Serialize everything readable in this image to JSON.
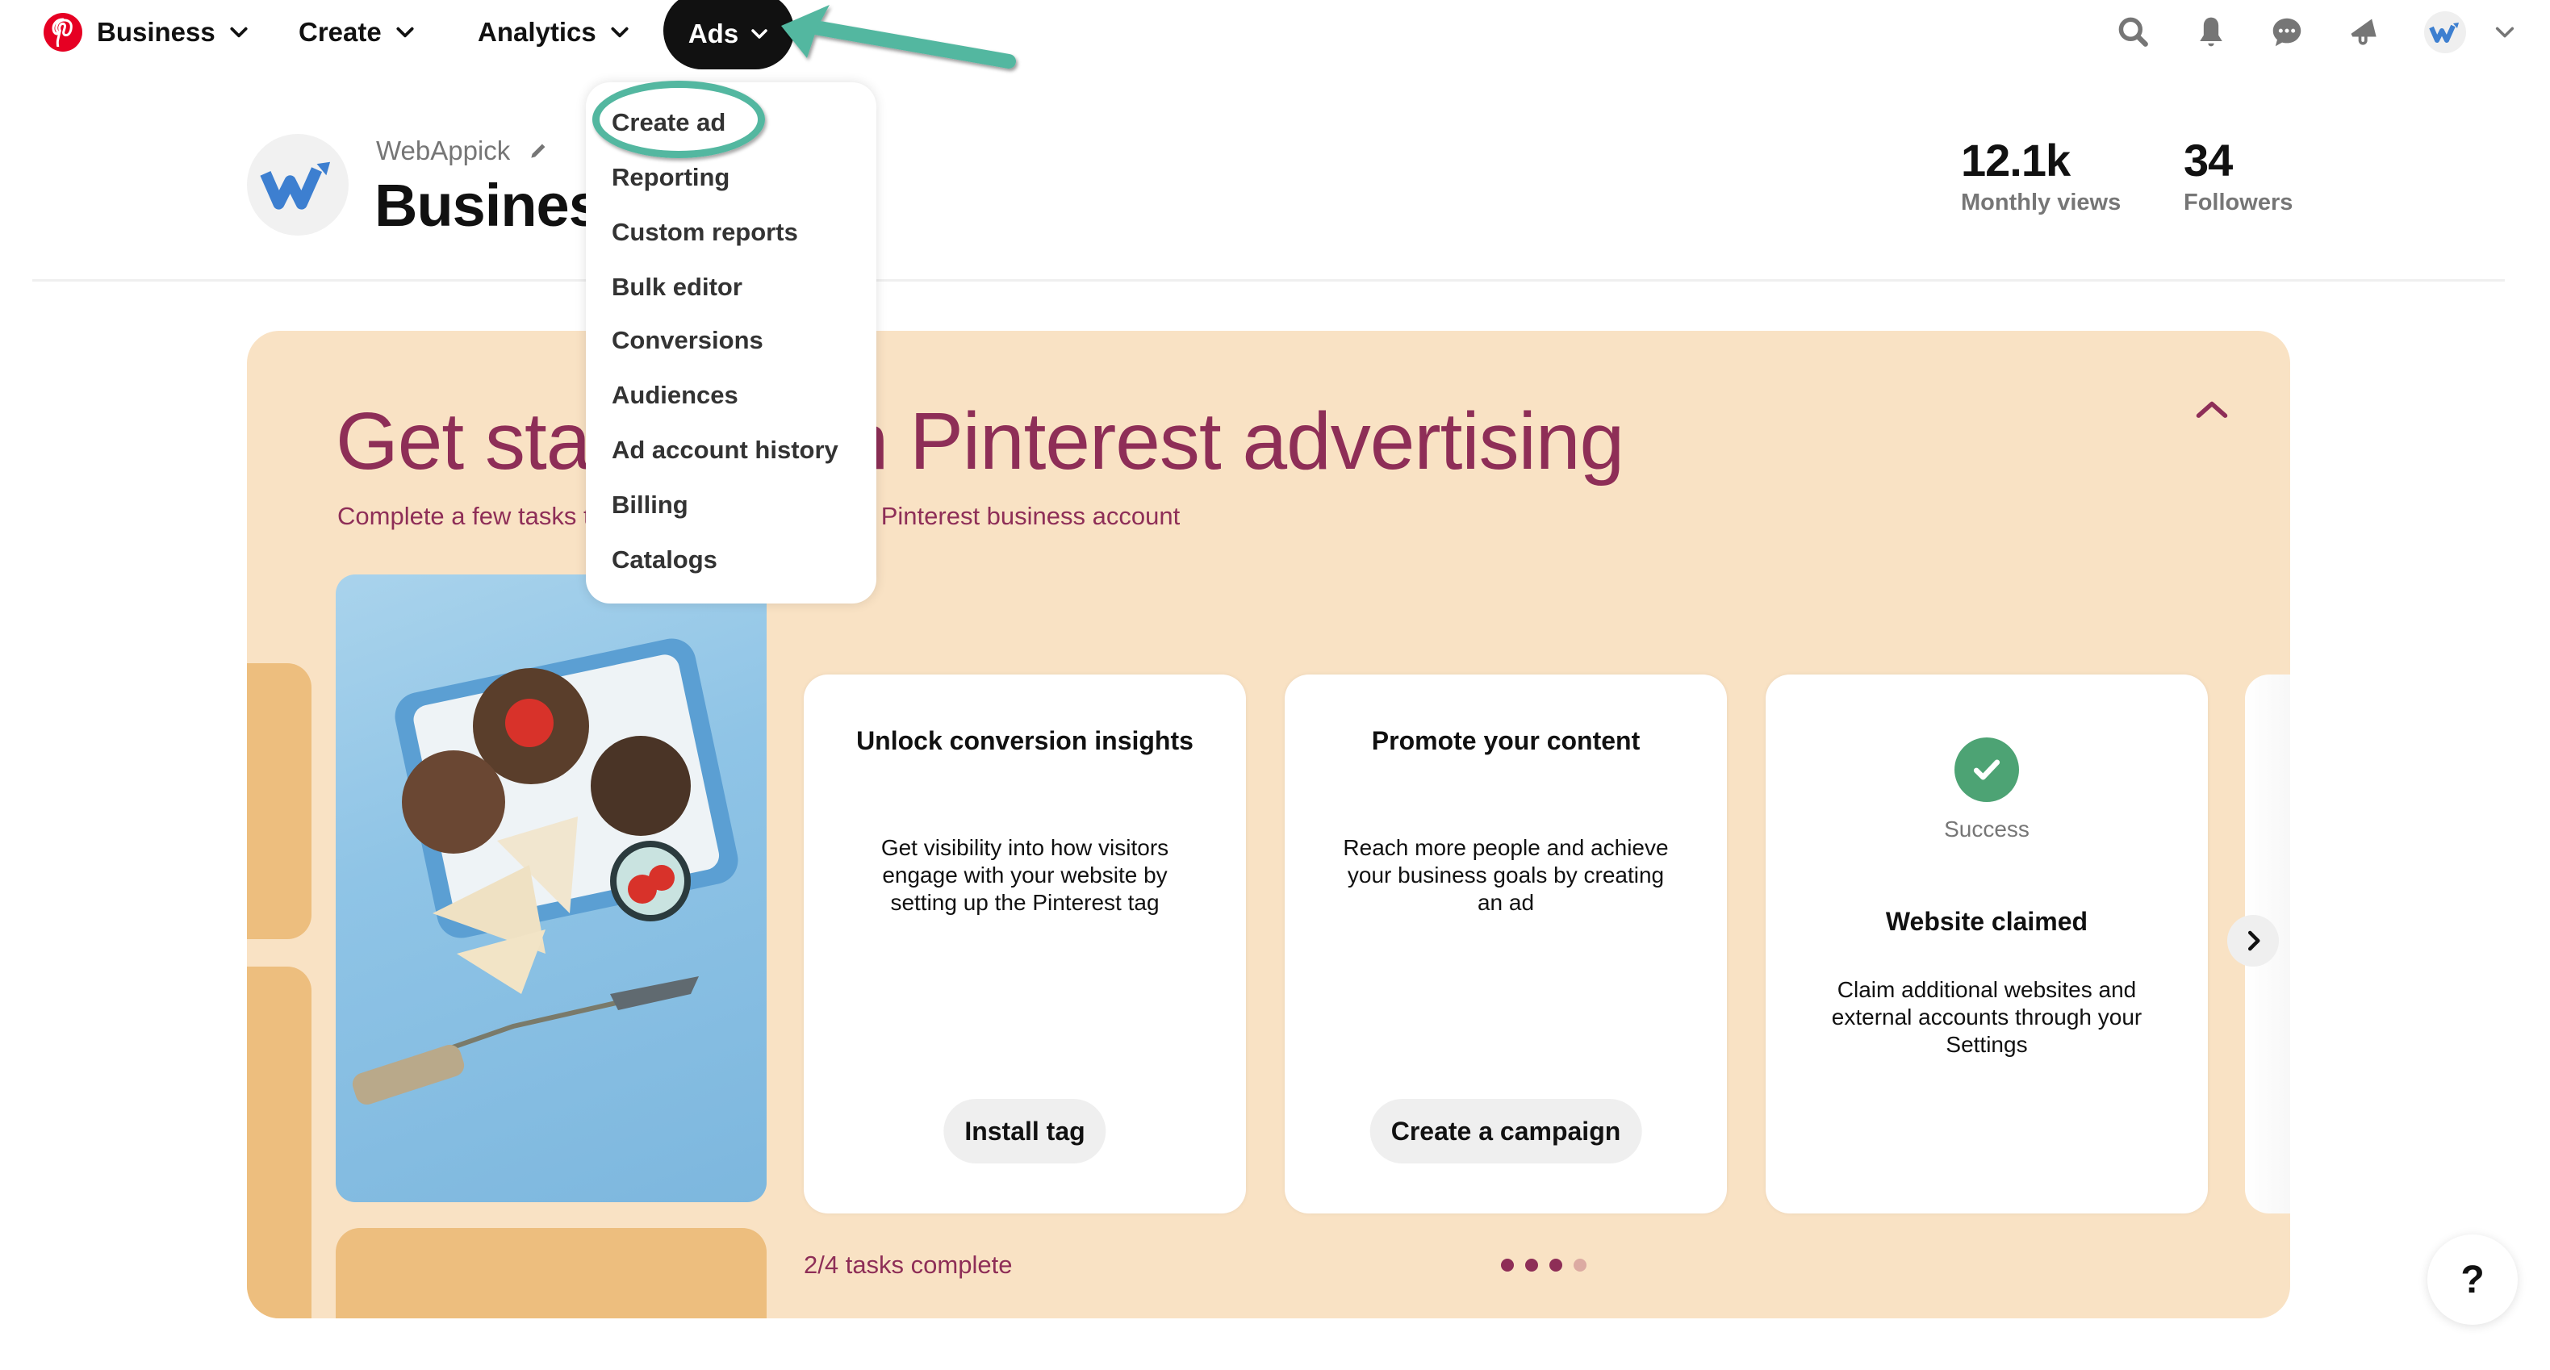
{
  "nav": {
    "items": [
      {
        "label": "Business",
        "icon": "chevron-down-icon"
      },
      {
        "label": "Create",
        "icon": "chevron-down-icon"
      },
      {
        "label": "Analytics",
        "icon": "chevron-down-icon"
      },
      {
        "label": "Ads",
        "icon": "chevron-down-icon",
        "active": true
      }
    ],
    "right_icons": [
      "search-icon",
      "bell-icon",
      "chat-icon",
      "megaphone-icon",
      "account-avatar",
      "chevron-down-icon"
    ]
  },
  "ads_menu": {
    "items": [
      "Create ad",
      "Reporting",
      "Custom reports",
      "Bulk editor",
      "Conversions",
      "Audiences",
      "Ad account history",
      "Billing",
      "Catalogs"
    ],
    "highlighted": "Create ad"
  },
  "profile": {
    "name": "WebAppick",
    "title": "Business",
    "stats": [
      {
        "value": "12.1k",
        "label": "Monthly views"
      },
      {
        "value": "34",
        "label": "Followers"
      }
    ]
  },
  "banner": {
    "title": "Get started with Pinterest advertising",
    "subtitle": "Complete a few tasks to get the most out of your Pinterest business account",
    "cards": [
      {
        "title": "Unlock conversion insights",
        "description": "Get visibility into how visitors engage with your website by setting up the Pinterest tag",
        "button": "Install tag"
      },
      {
        "title": "Promote your content",
        "description": "Reach more people and achieve your business goals by creating an ad",
        "button": "Create a campaign"
      },
      {
        "status": "Success",
        "title": "Website claimed",
        "description": "Claim additional websites and external accounts through your Settings"
      }
    ],
    "progress_text": "2/4 tasks complete",
    "pagination": {
      "total": 4,
      "active_dots": 3
    }
  },
  "help": {
    "label": "?"
  },
  "colors": {
    "brand_red": "#e60023",
    "banner_bg": "#f9e2c4",
    "banner_text": "#8e2e57",
    "tan": "#edbe7e",
    "success": "#4da374",
    "annotation": "#53b7a0"
  }
}
